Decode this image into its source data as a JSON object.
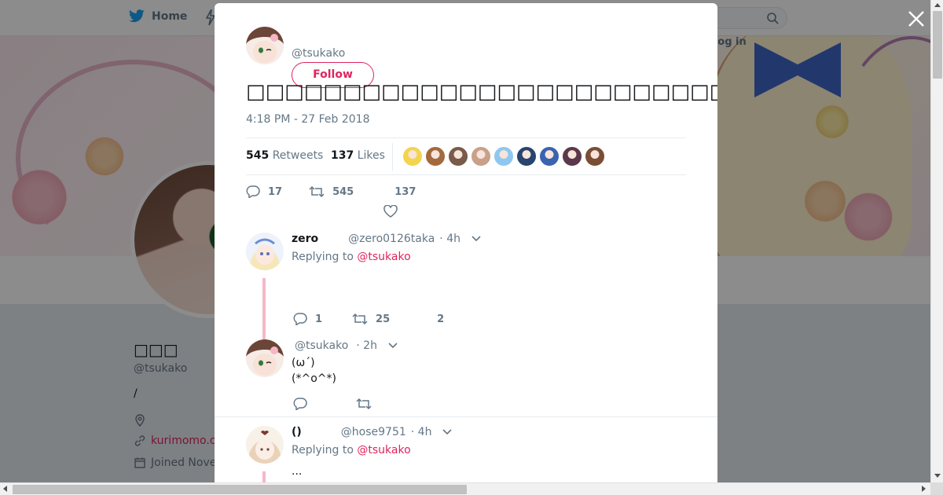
{
  "nav": {
    "home_label": "Home",
    "login_label": "Log in"
  },
  "profile": {
    "name": "□□□",
    "handle": "@tsukako",
    "bio": "/",
    "url_text": "kurimomo.c",
    "joined_text": "Joined Nove"
  },
  "tweet": {
    "author_handle": "@tsukako",
    "follow_label": "Follow",
    "text": "□□□□□□□□□□□□□□□□□□□□□□□□□□□□□□□□□□□□□□□□□□□□□□□□□□RT□□□",
    "timestamp": "4:18 PM - 27 Feb 2018",
    "retweets_count": "545",
    "retweets_label": "Retweets",
    "likes_count": "137",
    "likes_label": "Likes",
    "action_replies": "17",
    "action_retweets": "545",
    "action_likes": "137",
    "liker_colors": [
      "#f3d44f",
      "#a36a3e",
      "#7a5a4a",
      "#c9a089",
      "#8fc8ee",
      "#29446e",
      "#3a64b0",
      "#5a3a4a",
      "#7a4e36"
    ]
  },
  "replies": [
    {
      "name": "zero",
      "handle": "@zero0126taka",
      "time": "· 4h",
      "replying_prefix": "Replying to",
      "mention": "@tsukako",
      "body": "",
      "replies": "1",
      "retweets": "25",
      "likes": "2"
    },
    {
      "name": "",
      "handle": "@tsukako",
      "time": "· 2h",
      "body_line1": "(ω´)",
      "body_line2": "(*^o^*)",
      "replies": "",
      "retweets": "",
      "likes": ""
    },
    {
      "name": "()",
      "handle": "@hose9751",
      "time": "· 4h",
      "replying_prefix": "Replying to",
      "mention": "@tsukako",
      "body": "..."
    }
  ],
  "icons": {
    "close": "close-icon",
    "twitter_bird": "twitter-bird-icon",
    "search": "search-icon",
    "reply": "reply-icon",
    "retweet": "retweet-icon",
    "like": "heart-icon",
    "chevron": "chevron-down-icon"
  },
  "colors": {
    "accent": "#e0245e",
    "twitter_blue": "#1da1f2",
    "muted": "#657786",
    "thread_line": "#f5b8c9"
  }
}
